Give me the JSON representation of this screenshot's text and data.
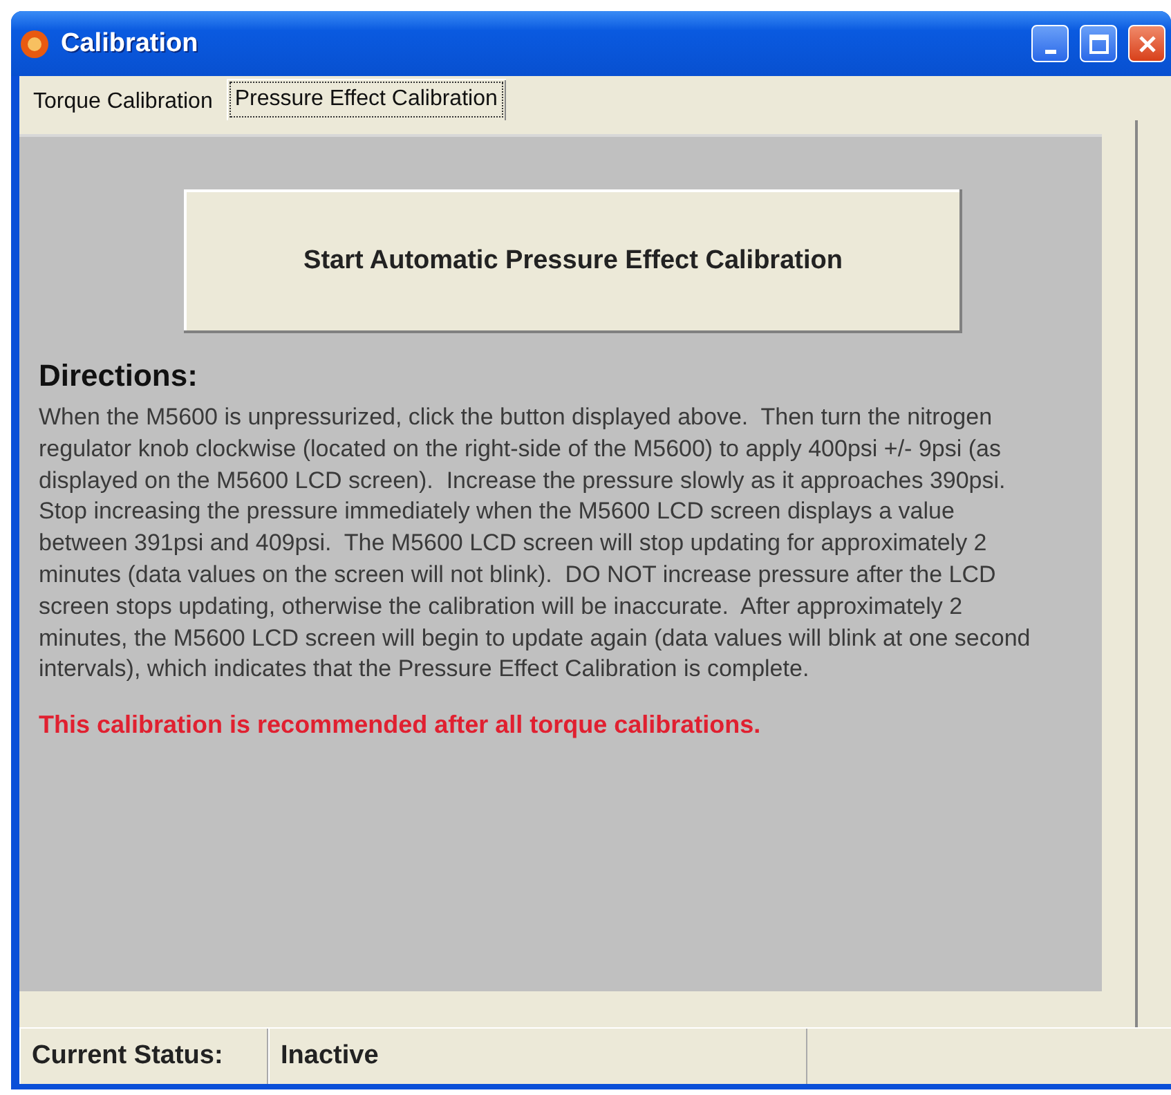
{
  "window": {
    "title": "Calibration"
  },
  "tabs": [
    {
      "label": "Torque Calibration",
      "selected": false
    },
    {
      "label": "Pressure Effect Calibration",
      "selected": true
    }
  ],
  "start_button": "Start Automatic Pressure Effect Calibration",
  "directions": {
    "heading": "Directions:",
    "text": "When the M5600 is unpressurized, click the button displayed above.  Then turn the nitrogen regulator knob clockwise (located on the right-side of the M5600) to apply 400psi +/- 9psi (as displayed on the M5600 LCD screen).  Increase the pressure slowly as it approaches 390psi.  Stop increasing the pressure immediately when the M5600 LCD screen displays a value between 391psi and 409psi.  The M5600 LCD screen will stop updating for approximately 2 minutes (data values on the screen will not blink).  DO NOT increase pressure after the LCD screen stops updating, otherwise the calibration will be inaccurate.  After approximately 2 minutes, the M5600 LCD screen will begin to update again (data values will blink at one second intervals), which indicates that the Pressure Effect Calibration is complete.",
    "note": "This calibration is recommended after all torque calibrations."
  },
  "status_bar": {
    "label": "Current Status:",
    "value": "Inactive"
  }
}
